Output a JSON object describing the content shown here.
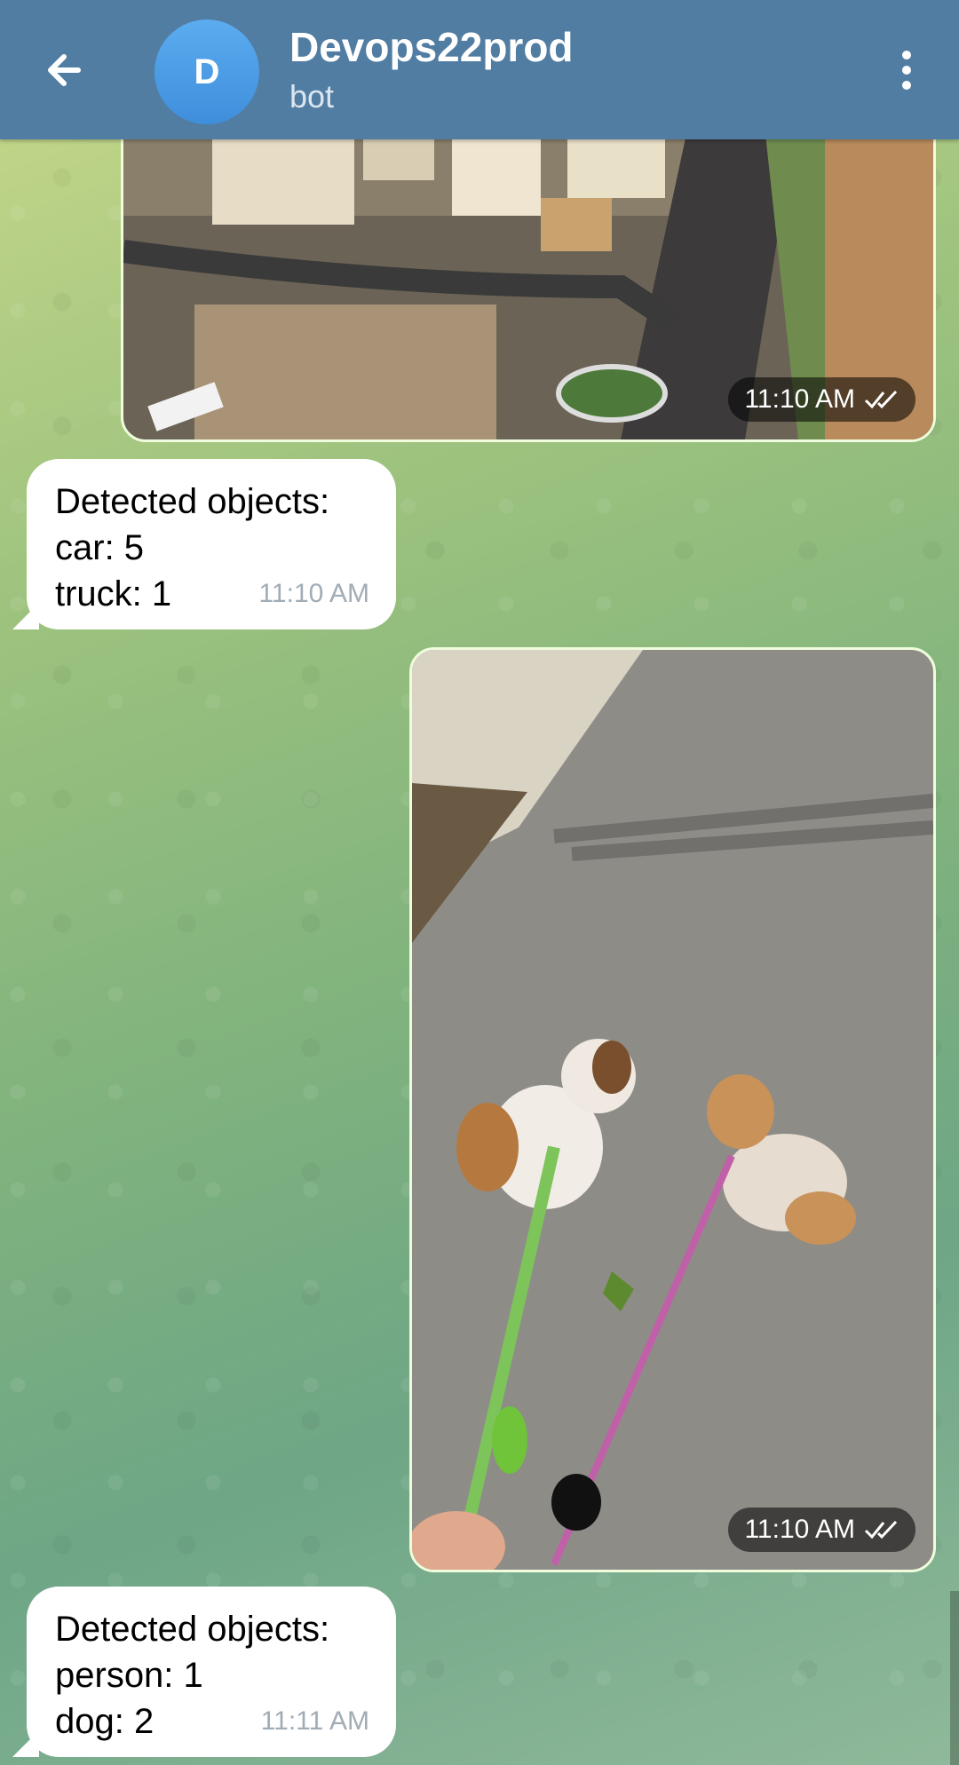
{
  "header": {
    "title": "Devops22prod",
    "subtitle": "bot",
    "avatar_letter": "D",
    "colors": {
      "bar": "#517da2",
      "avatar": "#4a9be6"
    }
  },
  "messages": [
    {
      "type": "photo",
      "direction": "outgoing",
      "description_icon": "city-photo",
      "time": "11:10 AM",
      "status": "read"
    },
    {
      "type": "text",
      "direction": "incoming",
      "lines": [
        "Detected objects:",
        "car: 5",
        "truck: 1"
      ],
      "time": "11:10 AM"
    },
    {
      "type": "photo",
      "direction": "outgoing",
      "description_icon": "dogs-photo",
      "time": "11:10 AM",
      "status": "read"
    },
    {
      "type": "text",
      "direction": "incoming",
      "lines": [
        "Detected objects:",
        "person: 1",
        "dog: 2"
      ],
      "time": "11:11 AM"
    }
  ]
}
